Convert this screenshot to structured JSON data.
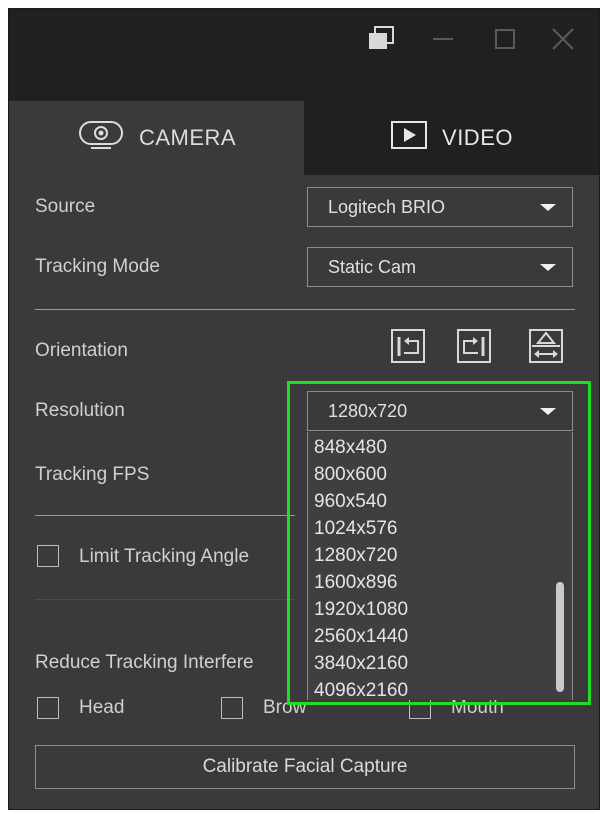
{
  "tabs": {
    "camera_label": "CAMERA",
    "video_label": "VIDEO"
  },
  "fields": {
    "source_label": "Source",
    "source_value": "Logitech BRIO",
    "tracking_mode_label": "Tracking Mode",
    "tracking_mode_value": "Static Cam",
    "orientation_label": "Orientation",
    "resolution_label": "Resolution",
    "resolution_value": "1280x720",
    "tracking_fps_label": "Tracking FPS",
    "limit_tracking_angle_label": "Limit Tracking Angle",
    "reduce_interference_label": "Reduce Tracking Interfere",
    "head_label": "Head",
    "brow_label": "Brow",
    "mouth_label": "Mouth"
  },
  "resolution_options": [
    "848x480",
    "800x600",
    "960x540",
    "1024x576",
    "1280x720",
    "1600x896",
    "1920x1080",
    "2560x1440",
    "3840x2160",
    "4096x2160"
  ],
  "calibrate_label": "Calibrate Facial Capture",
  "colors": {
    "highlight": "#22dd22",
    "panel_bg": "#3a3a3a",
    "title_bg": "#202020"
  }
}
